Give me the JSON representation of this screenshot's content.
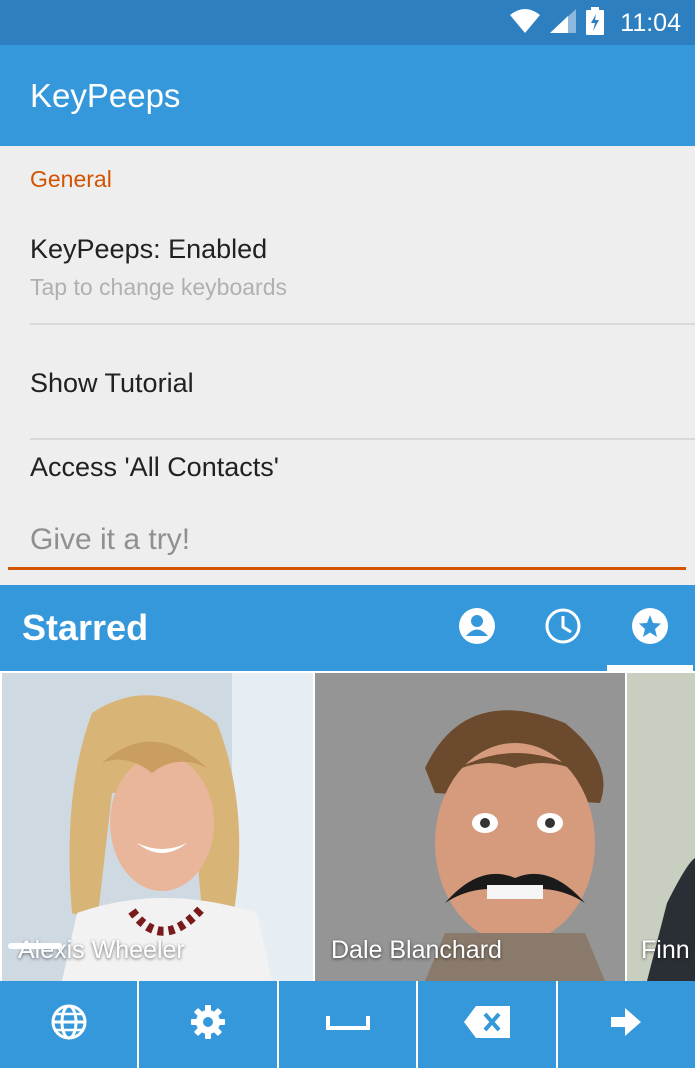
{
  "status_bar": {
    "time": "11:04",
    "icons": [
      "wifi-icon",
      "signal-icon",
      "battery-charging-icon"
    ]
  },
  "app_bar": {
    "title": "KeyPeeps"
  },
  "settings": {
    "section": "General",
    "items": [
      {
        "title": "KeyPeeps: Enabled",
        "subtitle": "Tap to change keyboards"
      },
      {
        "title": "Show Tutorial"
      },
      {
        "title": "Access 'All Contacts'"
      }
    ],
    "try_input": {
      "placeholder": "Give it a try!",
      "value": ""
    }
  },
  "keyboard": {
    "title": "Starred",
    "tabs": [
      {
        "icon": "contact-icon",
        "active": false
      },
      {
        "icon": "recent-clock-icon",
        "active": false
      },
      {
        "icon": "star-icon",
        "active": true
      }
    ],
    "contacts": [
      {
        "name": "Alexis Wheeler"
      },
      {
        "name": "Dale Blanchard"
      },
      {
        "name": "Finn"
      }
    ],
    "bottom_keys": [
      "globe-icon",
      "gear-icon",
      "space-icon",
      "backspace-icon",
      "arrow-right-icon"
    ]
  },
  "colors": {
    "primary": "#3598db",
    "status_bar": "#2d7fbf",
    "accent": "#d35400",
    "background": "#eeeeee"
  }
}
